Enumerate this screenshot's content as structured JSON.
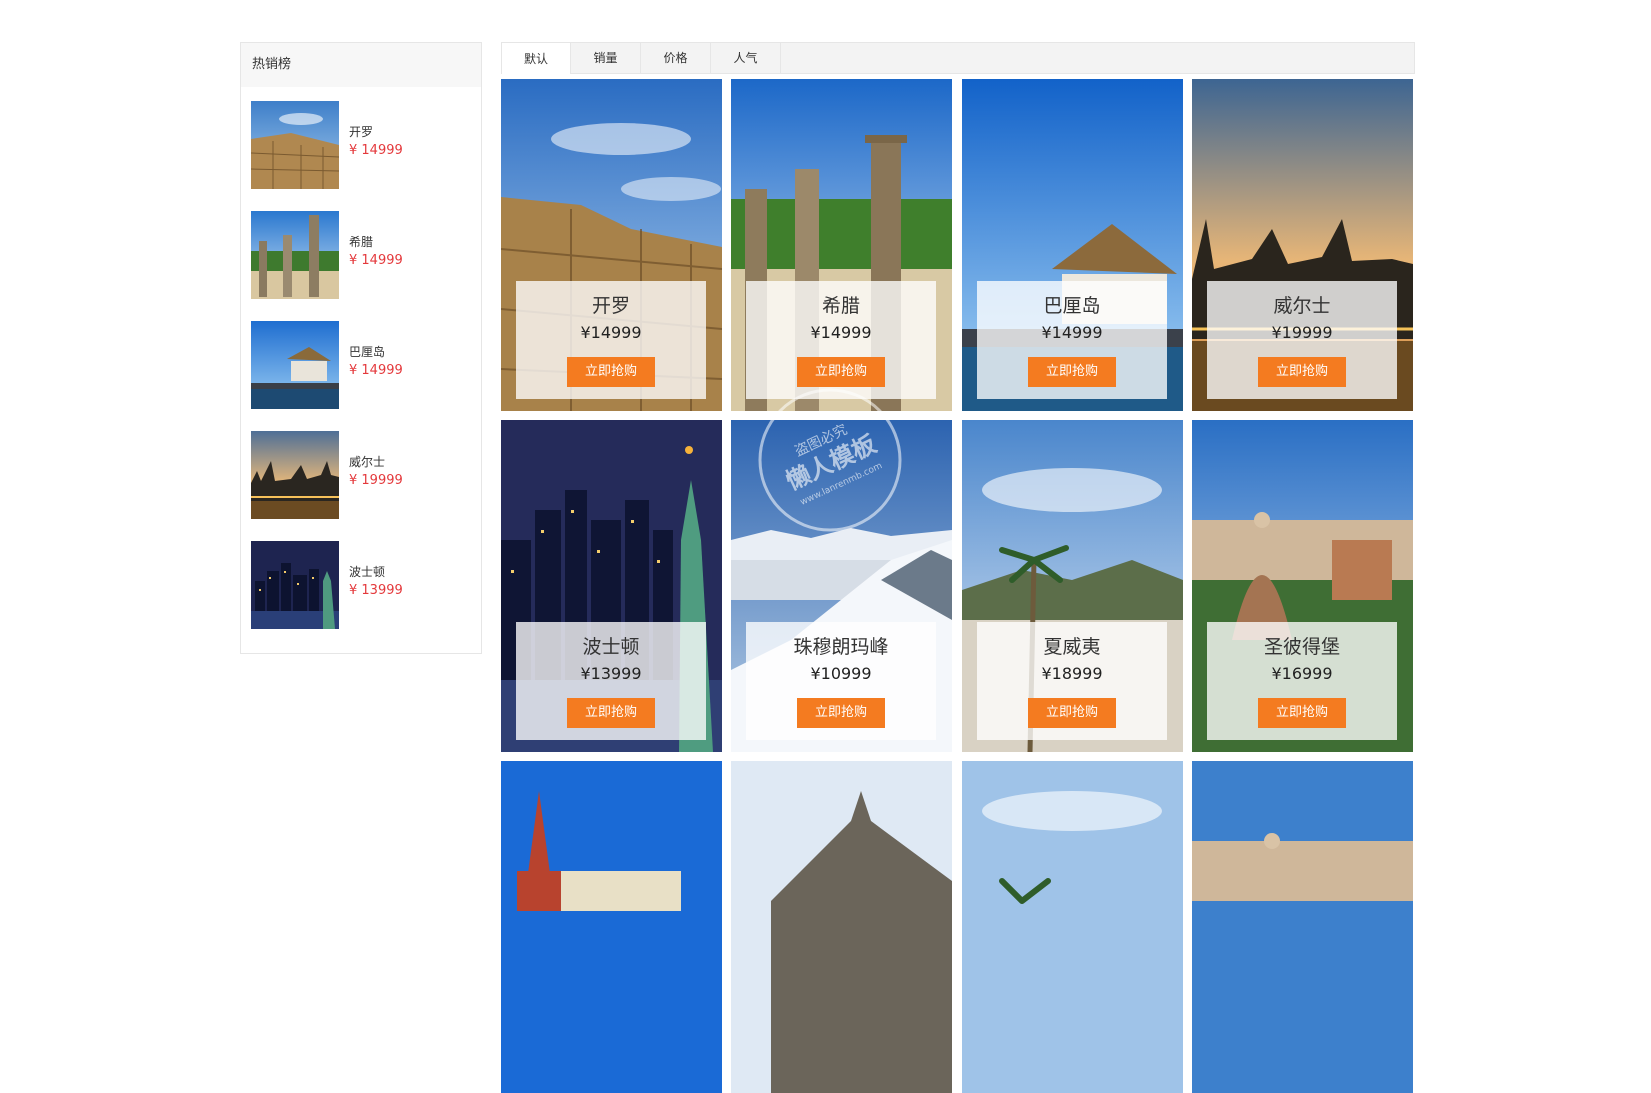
{
  "sidebar": {
    "title": "热销榜",
    "items": [
      {
        "name": "开罗",
        "price": "¥ 14999"
      },
      {
        "name": "希腊",
        "price": "¥ 14999"
      },
      {
        "name": "巴厘岛",
        "price": "¥ 14999"
      },
      {
        "name": "威尔士",
        "price": "¥ 19999"
      },
      {
        "name": "波士顿",
        "price": "¥ 13999"
      }
    ]
  },
  "tabs": [
    {
      "label": "默认",
      "active": true
    },
    {
      "label": "销量",
      "active": false
    },
    {
      "label": "价格",
      "active": false
    },
    {
      "label": "人气",
      "active": false
    }
  ],
  "products": [
    {
      "name": "开罗",
      "price": "¥14999",
      "button": "立即抢购"
    },
    {
      "name": "希腊",
      "price": "¥14999",
      "button": "立即抢购"
    },
    {
      "name": "巴厘岛",
      "price": "¥14999",
      "button": "立即抢购"
    },
    {
      "name": "威尔士",
      "price": "¥19999",
      "button": "立即抢购"
    },
    {
      "name": "波士顿",
      "price": "¥13999",
      "button": "立即抢购"
    },
    {
      "name": "珠穆朗玛峰",
      "price": "¥10999",
      "button": "立即抢购"
    },
    {
      "name": "夏威夷",
      "price": "¥18999",
      "button": "立即抢购"
    },
    {
      "name": "圣彼得堡",
      "price": "¥16999",
      "button": "立即抢购"
    }
  ],
  "watermark": {
    "line1": "盗图必究",
    "line2": "懒人模板",
    "line3": "www.lanrenmb.com"
  },
  "colors": {
    "accent": "#f47b20",
    "price_red": "#e4393c"
  }
}
